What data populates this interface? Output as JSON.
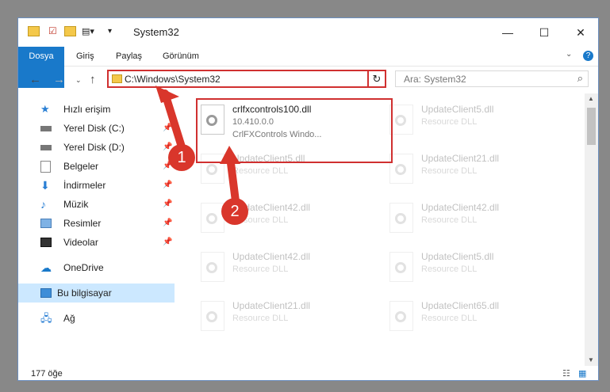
{
  "window": {
    "title": "System32"
  },
  "ribbon": {
    "tabs": [
      "Dosya",
      "Giriş",
      "Paylaş",
      "Görünüm"
    ]
  },
  "address": {
    "path": "C:\\Windows\\System32",
    "search_placeholder": "Ara: System32"
  },
  "nav": {
    "items": [
      {
        "label": "Hızlı erişim",
        "icon": "star-icon",
        "pinned": false
      },
      {
        "label": "Yerel Disk (C:)",
        "icon": "drive-icon",
        "pinned": true
      },
      {
        "label": "Yerel Disk (D:)",
        "icon": "drive-icon",
        "pinned": true
      },
      {
        "label": "Belgeler",
        "icon": "documents-icon",
        "pinned": true
      },
      {
        "label": "İndirmeler",
        "icon": "download-icon",
        "pinned": true
      },
      {
        "label": "Müzik",
        "icon": "music-icon",
        "pinned": true
      },
      {
        "label": "Resimler",
        "icon": "pictures-icon",
        "pinned": true
      },
      {
        "label": "Videolar",
        "icon": "video-icon",
        "pinned": true
      },
      {
        "label": "OneDrive",
        "icon": "cloud-icon",
        "pinned": false
      },
      {
        "label": "Bu bilgisayar",
        "icon": "computer-icon",
        "pinned": false
      },
      {
        "label": "Ağ",
        "icon": "network-icon",
        "pinned": false
      }
    ]
  },
  "files": [
    {
      "name": "crlfxcontrols100.dll",
      "version": "10.410.0.0",
      "type": "CrlFXControls Windo..."
    },
    {
      "name": "UpdateClient5.dll",
      "type": "Resource DLL"
    },
    {
      "name": "UpdateClient5.dll",
      "type": "Resource DLL"
    },
    {
      "name": "UpdateClient21.dll",
      "type": "Resource DLL"
    },
    {
      "name": "UpdateClient42.dll",
      "type": "Resource DLL"
    },
    {
      "name": "UpdateClient42.dll",
      "type": "Resource DLL"
    },
    {
      "name": "UpdateClient42.dll",
      "type": "Resource DLL"
    },
    {
      "name": "UpdateClient5.dll",
      "type": "Resource DLL"
    },
    {
      "name": "UpdateClient21.dll",
      "type": "Resource DLL"
    },
    {
      "name": "UpdateClient65.dll",
      "type": "Resource DLL"
    }
  ],
  "status": {
    "count": "177 öğe"
  },
  "annotations": {
    "badge1": "1",
    "badge2": "2"
  },
  "colors": {
    "accent": "#1979ca",
    "highlight": "#d03030",
    "selection": "#cce8ff"
  }
}
